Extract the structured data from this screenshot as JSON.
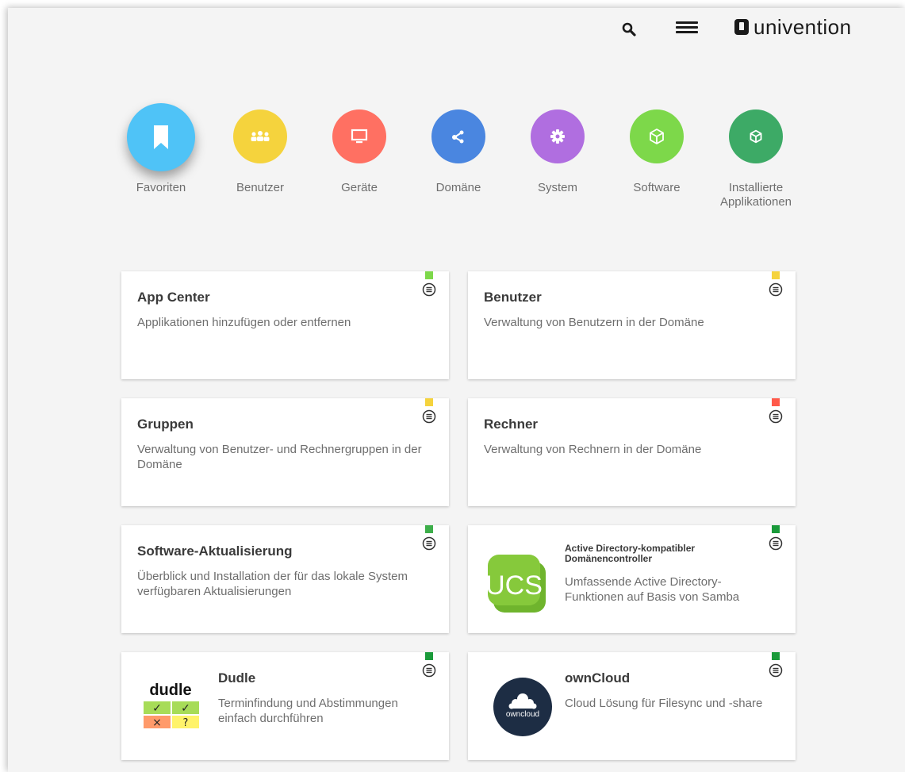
{
  "header": {
    "search_icon": "search-icon",
    "menu_icon": "hamburger-menu-icon",
    "brand": "univention"
  },
  "categories": [
    {
      "label": "Favoriten",
      "color": "#4fc3f7",
      "icon": "bookmark-icon",
      "active": true
    },
    {
      "label": "Benutzer",
      "color": "#f5d33d",
      "icon": "users-icon"
    },
    {
      "label": "Geräte",
      "color": "#ff7062",
      "icon": "monitor-icon"
    },
    {
      "label": "Domäne",
      "color": "#4a86e0",
      "icon": "share-icon"
    },
    {
      "label": "System",
      "color": "#b06ee0",
      "icon": "gear-icon"
    },
    {
      "label": "Software",
      "color": "#7dd84a",
      "icon": "box-icon"
    },
    {
      "label": "Installierte",
      "label2": "Applikationen",
      "color": "#3daa66",
      "icon": "box-icon"
    }
  ],
  "tiles": [
    {
      "title": "App Center",
      "desc": "Applikationen hinzufügen oder entfernen",
      "bookmark_color": "#7dd84a"
    },
    {
      "title": "Benutzer",
      "desc": "Verwaltung von Benutzern in der Domäne",
      "bookmark_color": "#f5d33d"
    },
    {
      "title": "Gruppen",
      "desc": "Verwaltung von Benutzer- und Rechnergruppen in der Domäne",
      "bookmark_color": "#f5d33d"
    },
    {
      "title": "Rechner",
      "desc": "Verwaltung von Rechnern in der Domäne",
      "bookmark_color": "#ff5a4a"
    },
    {
      "title": "Software-Aktualisierung",
      "desc": "Überblick und Installation der für das lokale System verfügbaren Aktualisierungen",
      "bookmark_color": "#3dae4a"
    },
    {
      "title": "Active Directory-kompatibler Domänencontroller",
      "desc": "Umfassende Active Directory-Funktionen auf Basis von Samba",
      "bookmark_color": "#1a9a3a",
      "logo_text": "UCS"
    },
    {
      "title": "Dudle",
      "desc": "Terminfindung und Abstimmungen einfach durchführen",
      "bookmark_color": "#1a9a3a",
      "logo_text": "dudle",
      "logo_cells": [
        "✓",
        "✓",
        "×",
        "?"
      ]
    },
    {
      "title": "ownCloud",
      "desc": "Cloud Lösung für Filesync und -share",
      "bookmark_color": "#1a9a3a",
      "logo_text": "owncloud"
    }
  ]
}
